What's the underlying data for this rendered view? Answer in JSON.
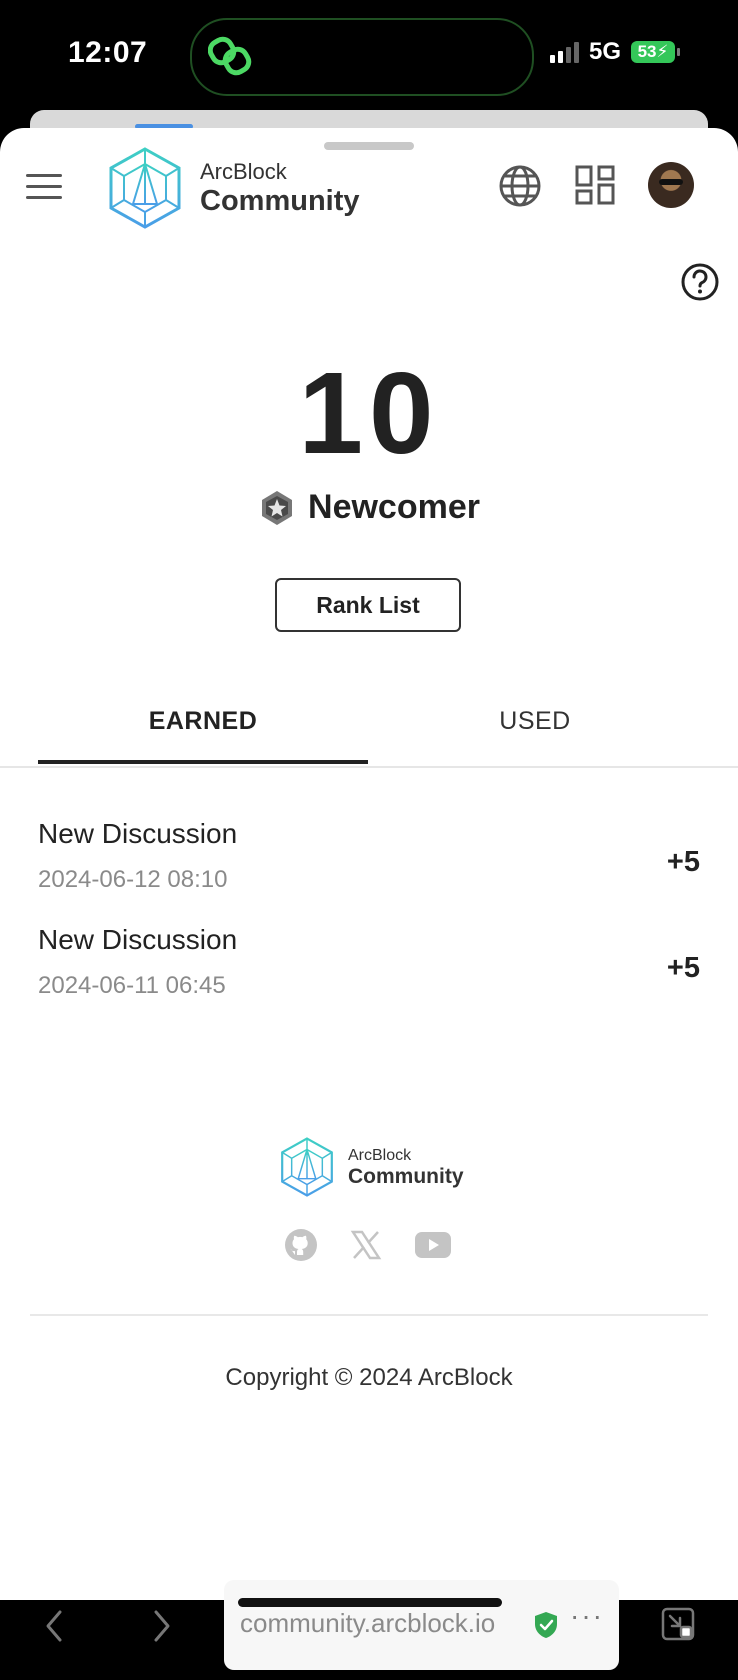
{
  "status_bar": {
    "time": "12:07",
    "network": "5G",
    "battery": "53"
  },
  "header": {
    "logo_brand": "ArcBlock",
    "logo_name": "Community",
    "icons": [
      "menu-icon",
      "globe-icon",
      "apps-grid-icon",
      "avatar"
    ]
  },
  "points": {
    "value": "10",
    "level_name": "Newcomer",
    "rank_button": "Rank List"
  },
  "tabs": [
    {
      "label": "EARNED",
      "active": true
    },
    {
      "label": "USED",
      "active": false
    }
  ],
  "records": [
    {
      "title": "New Discussion",
      "time": "2024-06-12 08:10",
      "points": "+5"
    },
    {
      "title": "New Discussion",
      "time": "2024-06-11 06:45",
      "points": "+5"
    }
  ],
  "footer": {
    "logo_brand": "ArcBlock",
    "logo_name": "Community",
    "socials": [
      "github-icon",
      "x-icon",
      "youtube-icon"
    ],
    "copyright": "Copyright © 2024 ArcBlock"
  },
  "browser": {
    "url": "community.arcblock.io",
    "more": "···"
  },
  "colors": {
    "accent_teal": "#3ecfc4",
    "accent_blue": "#4a90e2",
    "text_dark": "#222222",
    "text_muted": "#8a8a8a",
    "battery_green": "#34c759",
    "secure_green": "#34a853"
  }
}
